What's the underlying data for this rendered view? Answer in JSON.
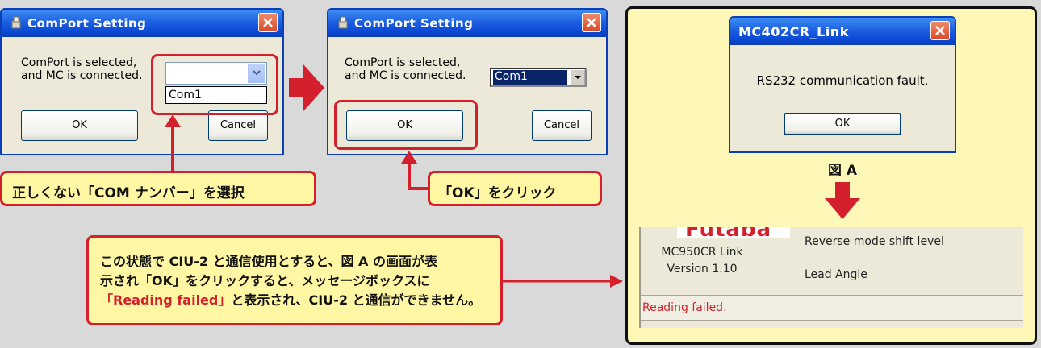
{
  "dialog1": {
    "title": "ComPort Setting",
    "message_line1": "ComPort is selected,",
    "message_line2": "and MC is connected.",
    "combo_value": "",
    "dropdown_option": "Com1",
    "ok_label": "OK",
    "cancel_label": "Cancel"
  },
  "dialog2": {
    "title": "ComPort Setting",
    "message_line1": "ComPort is selected,",
    "message_line2": "and MC is connected.",
    "combo_value": "Com1",
    "ok_label": "OK",
    "cancel_label": "Cancel"
  },
  "callout1": "正しくない「COM ナンバー」を選択",
  "callout2": "「OK」をクリック",
  "callout3": {
    "line1": "この状態で CIU-2 と通信使用とすると、図 A の画面が表",
    "line2": "示され「OK」をクリックすると、メッセージボックスに",
    "line3_highlight": "「Reading failed」",
    "line3_rest": "と表示され、CIU-2 と通信ができません。"
  },
  "alert": {
    "title": "MC402CR_Link",
    "message": "RS232 communication fault.",
    "ok_label": "OK"
  },
  "figure_label": "図 A",
  "app": {
    "logo_text": "Futaba",
    "product_name": "MC950CR Link",
    "version": "Version 1.10",
    "setting1": "Reverse mode shift level",
    "setting2": "Lead Angle",
    "status": "Reading failed."
  },
  "colors": {
    "accent_red": "#d4202c",
    "callout_fill": "#fff7a3",
    "panel_fill": "#fdf7b8",
    "xp_title_blue": "#0a49d6"
  }
}
